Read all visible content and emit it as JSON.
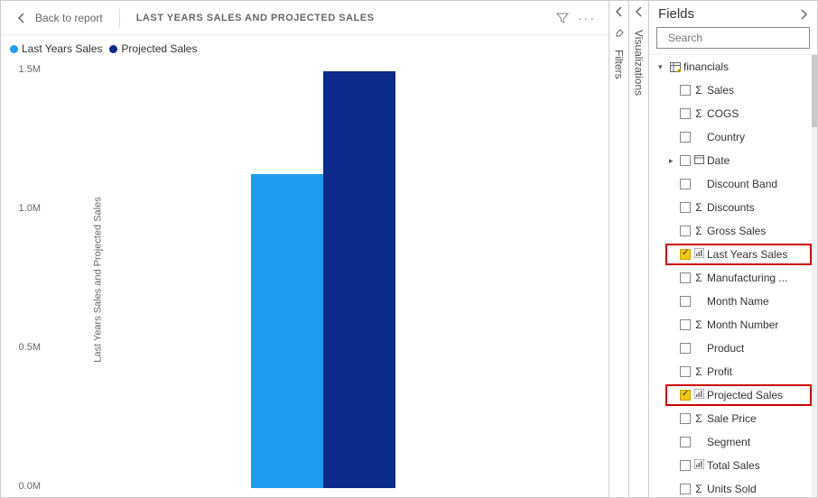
{
  "header": {
    "back_label": "Back to report",
    "title": "LAST YEARS SALES AND PROJECTED SALES"
  },
  "legend": {
    "items": [
      {
        "label": "Last Years Sales",
        "color": "#1f9cf0"
      },
      {
        "label": "Projected Sales",
        "color": "#0b2a8a"
      }
    ]
  },
  "chart_data": {
    "type": "bar",
    "categories": [
      ""
    ],
    "series": [
      {
        "name": "Last Years Sales",
        "values": [
          1130000
        ],
        "color": "#1f9cf0"
      },
      {
        "name": "Projected Sales",
        "values": [
          1500000
        ],
        "color": "#0b2a8a"
      }
    ],
    "title": "",
    "xlabel": "",
    "ylabel": "Last Years Sales and Projected Sales",
    "ylim": [
      0,
      1500000
    ],
    "yticks": [
      {
        "v": 0,
        "label": "0.0M"
      },
      {
        "v": 500000,
        "label": "0.5M"
      },
      {
        "v": 1000000,
        "label": "1.0M"
      },
      {
        "v": 1500000,
        "label": "1.5M"
      }
    ]
  },
  "rails": {
    "filters": "Filters",
    "viz": "Visualizations"
  },
  "fields": {
    "title": "Fields",
    "search_placeholder": "Search",
    "table": "financials",
    "items": [
      {
        "name": "Sales",
        "icon": "sigma",
        "checked": false
      },
      {
        "name": "COGS",
        "icon": "sigma",
        "checked": false
      },
      {
        "name": "Country",
        "icon": "",
        "checked": false
      },
      {
        "name": "Date",
        "icon": "date",
        "checked": false,
        "expandable": true
      },
      {
        "name": "Discount Band",
        "icon": "",
        "checked": false
      },
      {
        "name": "Discounts",
        "icon": "sigma",
        "checked": false
      },
      {
        "name": "Gross Sales",
        "icon": "sigma",
        "checked": false
      },
      {
        "name": "Last Years Sales",
        "icon": "measure",
        "checked": true,
        "highlight": true
      },
      {
        "name": "Manufacturing ...",
        "icon": "sigma",
        "checked": false
      },
      {
        "name": "Month Name",
        "icon": "",
        "checked": false
      },
      {
        "name": "Month Number",
        "icon": "sigma",
        "checked": false
      },
      {
        "name": "Product",
        "icon": "",
        "checked": false
      },
      {
        "name": "Profit",
        "icon": "sigma",
        "checked": false
      },
      {
        "name": "Projected Sales",
        "icon": "measure",
        "checked": true,
        "highlight": true
      },
      {
        "name": "Sale Price",
        "icon": "sigma",
        "checked": false
      },
      {
        "name": "Segment",
        "icon": "",
        "checked": false
      },
      {
        "name": "Total Sales",
        "icon": "measure",
        "checked": false
      },
      {
        "name": "Units Sold",
        "icon": "sigma",
        "checked": false
      }
    ]
  }
}
